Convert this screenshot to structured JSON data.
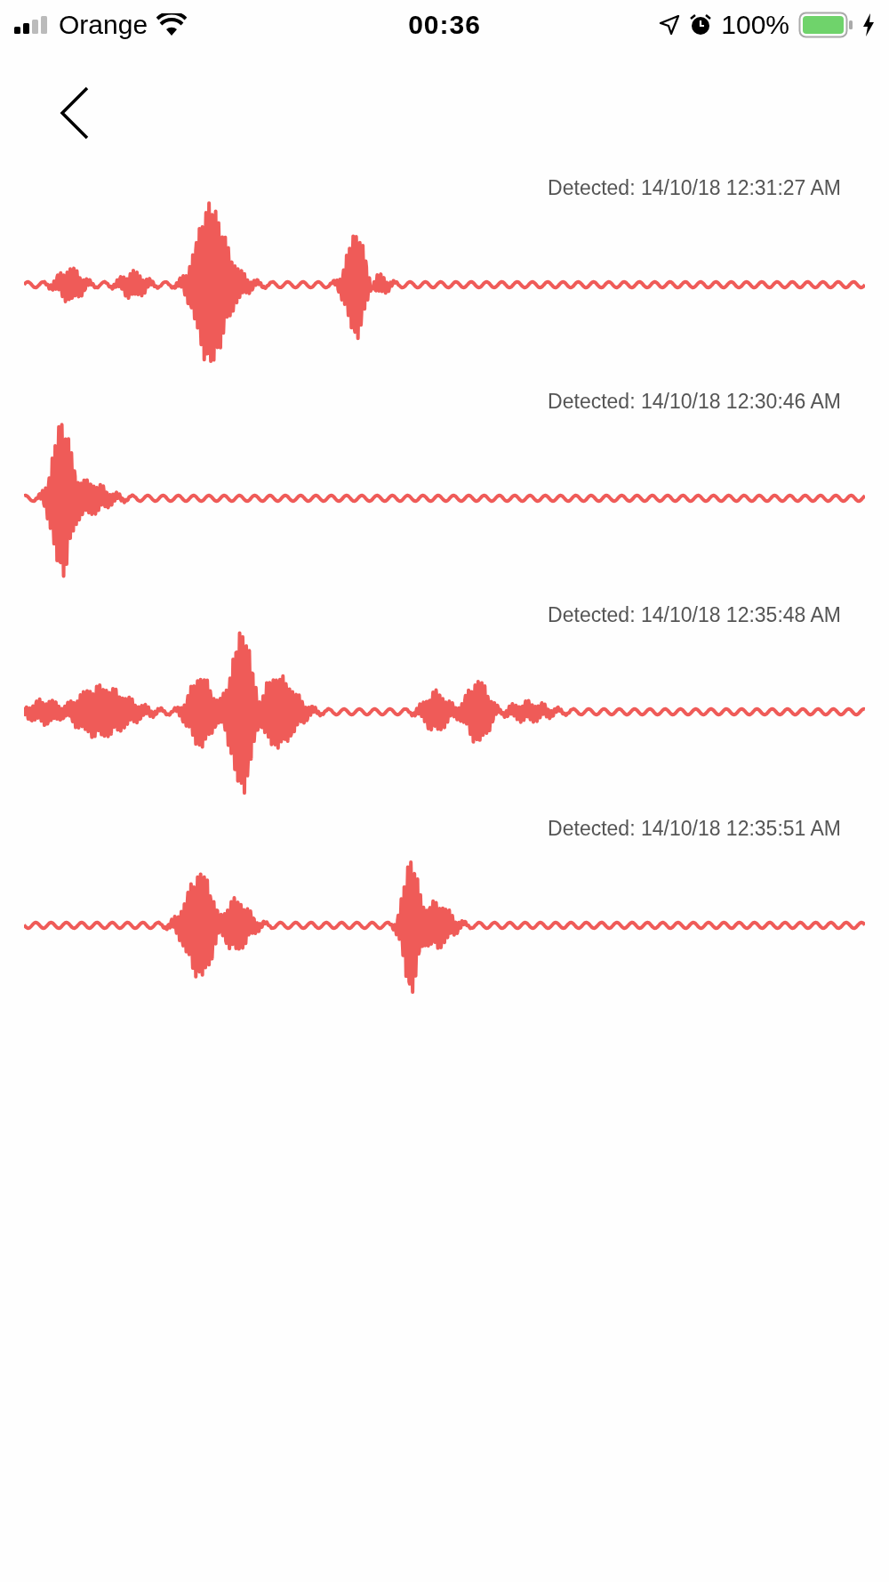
{
  "status_bar": {
    "carrier": "Orange",
    "time": "00:36",
    "battery": "100%"
  },
  "detections": [
    {
      "label": "Detected: 14/10/18 12:31:27 AM"
    },
    {
      "label": "Detected: 14/10/18 12:30:46 AM"
    },
    {
      "label": "Detected: 14/10/18 12:35:48 AM"
    },
    {
      "label": "Detected: 14/10/18 12:35:51 AM"
    }
  ]
}
